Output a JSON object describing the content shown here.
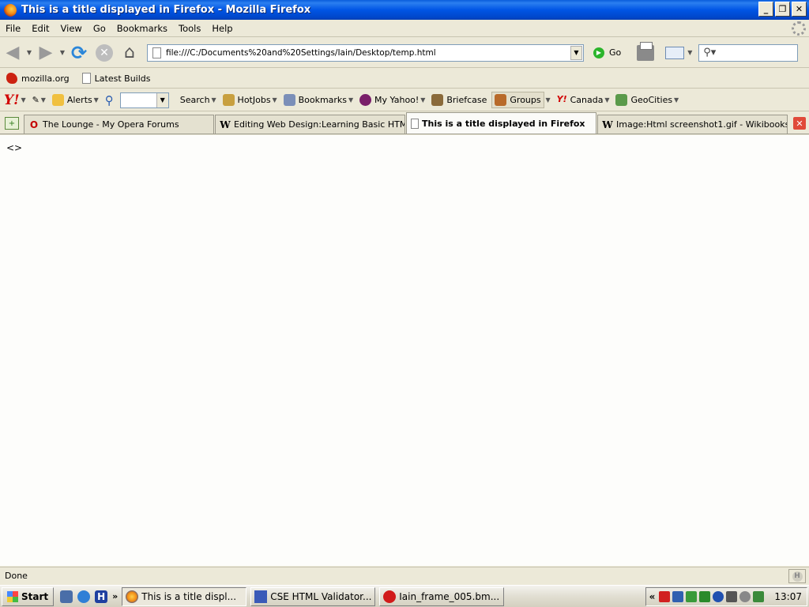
{
  "window": {
    "title": "This is a title displayed in Firefox - Mozilla Firefox",
    "controls": {
      "minimize": "_",
      "restore": "❐",
      "close": "✕"
    }
  },
  "menubar": {
    "items": [
      {
        "label": "File"
      },
      {
        "label": "Edit"
      },
      {
        "label": "View"
      },
      {
        "label": "Go"
      },
      {
        "label": "Bookmarks"
      },
      {
        "label": "Tools"
      },
      {
        "label": "Help"
      }
    ]
  },
  "navigation": {
    "url": "file:///C:/Documents%20and%20Settings/Iain/Desktop/temp.html",
    "go_label": "Go"
  },
  "bookmarks_toolbar": {
    "items": [
      {
        "label": "mozilla.org",
        "icon": "mozilla-icon"
      },
      {
        "label": "Latest Builds",
        "icon": "page-icon"
      }
    ]
  },
  "yahoo_toolbar": {
    "logo": "Y!",
    "alerts": "Alerts",
    "search": "Search",
    "hotjobs": "HotJobs",
    "bookmarks": "Bookmarks",
    "my_yahoo": "My Yahoo!",
    "briefcase": "Briefcase",
    "groups": "Groups",
    "canada": "Canada",
    "geocities": "GeoCities"
  },
  "tabs": [
    {
      "label": "The Lounge - My Opera Forums",
      "icon": "opera-icon",
      "active": false
    },
    {
      "label": "Editing Web Design:Learning Basic HTML ...",
      "icon": "wikipedia-icon",
      "active": false
    },
    {
      "label": "This is a title displayed in Firefox",
      "icon": "page-icon",
      "active": true
    },
    {
      "label": "Image:Html screenshot1.gif - Wikibooks",
      "icon": "wikipedia-icon",
      "active": false
    }
  ],
  "content": {
    "text": "<>"
  },
  "status": {
    "text": "Done"
  },
  "taskbar": {
    "start_label": "Start",
    "quicklaunch_overflow": "»",
    "tasks": [
      {
        "label": "This is a title displ...",
        "active": true
      },
      {
        "label": "CSE HTML Validator...",
        "active": false
      },
      {
        "label": "Iain_frame_005.bm...",
        "active": false
      }
    ],
    "tray_overflow": "«",
    "clock": "13:07"
  }
}
